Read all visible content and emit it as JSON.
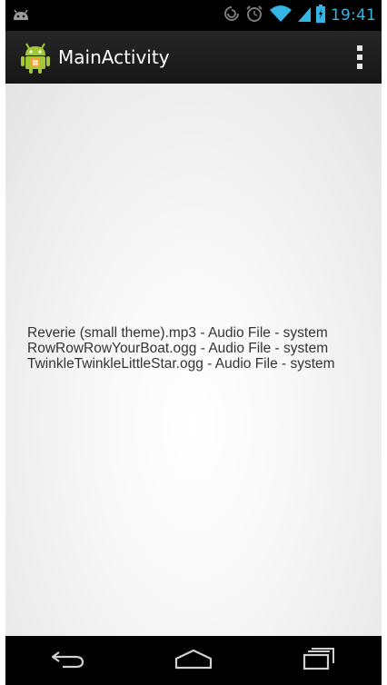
{
  "status_bar": {
    "time": "19:41",
    "icons": [
      "android-notification-icon",
      "sync-icon",
      "alarm-icon",
      "wifi-icon",
      "signal-icon",
      "battery-icon"
    ],
    "accent_color": "#33b5e5"
  },
  "action_bar": {
    "title": "MainActivity",
    "app_icon": "android-robot-icon",
    "overflow_icon": "overflow-menu-icon",
    "background": "#1e1e1e"
  },
  "content": {
    "items": [
      "Reverie (small theme).mp3 - Audio File - system",
      "RowRowRowYourBoat.ogg - Audio File - system",
      "TwinkleTwinkleLittleStar.ogg - Audio File - system"
    ]
  },
  "nav_bar": {
    "buttons": [
      "back-icon",
      "home-icon",
      "recent-apps-icon"
    ]
  }
}
